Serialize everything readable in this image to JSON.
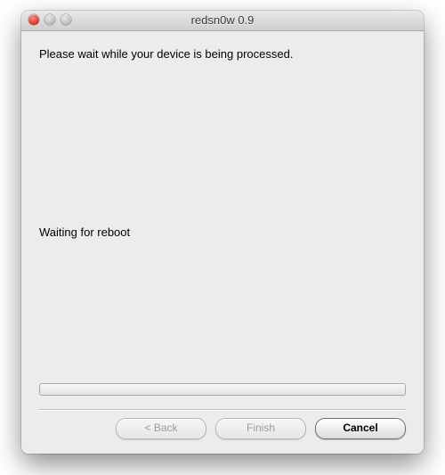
{
  "window": {
    "title": "redsn0w 0.9"
  },
  "body": {
    "instruction": "Please wait while your device is being processed.",
    "status": "Waiting for reboot"
  },
  "buttons": {
    "back": "< Back",
    "finish": "Finish",
    "cancel": "Cancel"
  }
}
